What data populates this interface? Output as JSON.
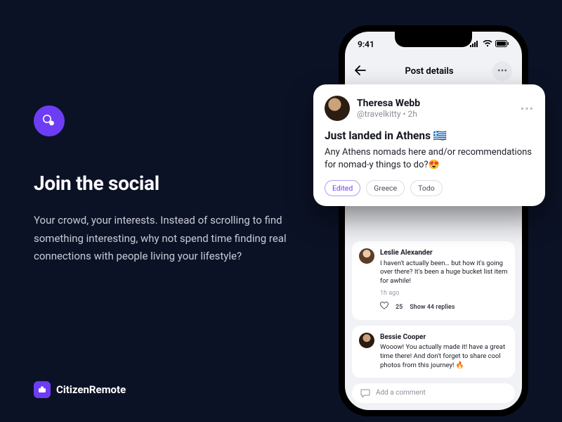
{
  "left": {
    "heading": "Join the social",
    "body": "Your crowd, your interests. Instead of scrolling to find something interesting, why not spend time finding real connections with people living your lifestyle?"
  },
  "footer": {
    "brand": "CitizenRemote"
  },
  "phone": {
    "status_time": "9:41",
    "nav_title": "Post details"
  },
  "post": {
    "name": "Theresa Webb",
    "handle": "@travelkitty • 2h",
    "title": "Just landed in Athens 🇬🇷",
    "body": "Any Athens nomads here and/or recommendations for nomad-y things to do?😍",
    "tags": {
      "edited": "Edited",
      "t1": "Greece",
      "t2": "Todo"
    }
  },
  "comments": [
    {
      "name": "Leslie Alexander",
      "text": "I haven't actually been… but how it's going over there? It's been a huge bucket list item for awhile!",
      "time": "1h ago",
      "likes": "25",
      "replies": "Show 44 replies"
    },
    {
      "name": "Bessie Cooper",
      "text": "Wooow! You actually made it! have a great time there! And don't forget to share cool photos from this journey! 🔥",
      "time": "",
      "likes": "",
      "replies": ""
    }
  ],
  "add_comment_placeholder": "Add a comment"
}
